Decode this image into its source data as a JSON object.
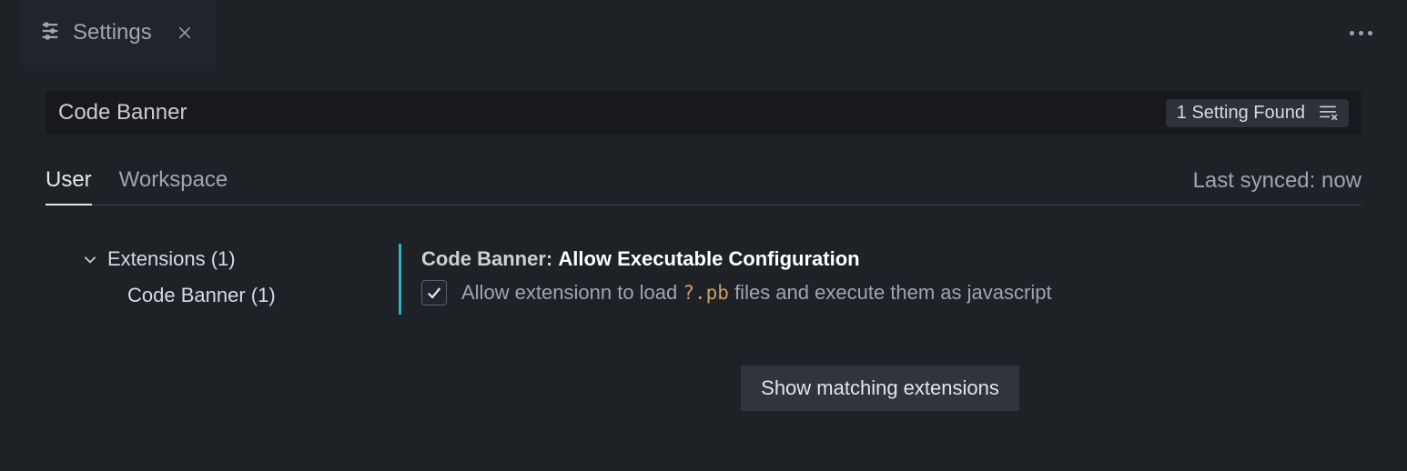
{
  "tab": {
    "title": "Settings"
  },
  "search": {
    "value": "Code Banner"
  },
  "results": {
    "text": "1 Setting Found"
  },
  "scopes": {
    "user": "User",
    "workspace": "Workspace"
  },
  "sync": {
    "text": "Last synced: now"
  },
  "tree": {
    "parent": "Extensions (1)",
    "child": "Code Banner (1)"
  },
  "setting": {
    "prefix": "Code Banner: ",
    "name": "Allow Executable Configuration",
    "desc_pre": "Allow extensionn to load ",
    "desc_code": "?.pb",
    "desc_post": " files and execute them as javascript"
  },
  "showExtensions": {
    "label": "Show matching extensions"
  }
}
